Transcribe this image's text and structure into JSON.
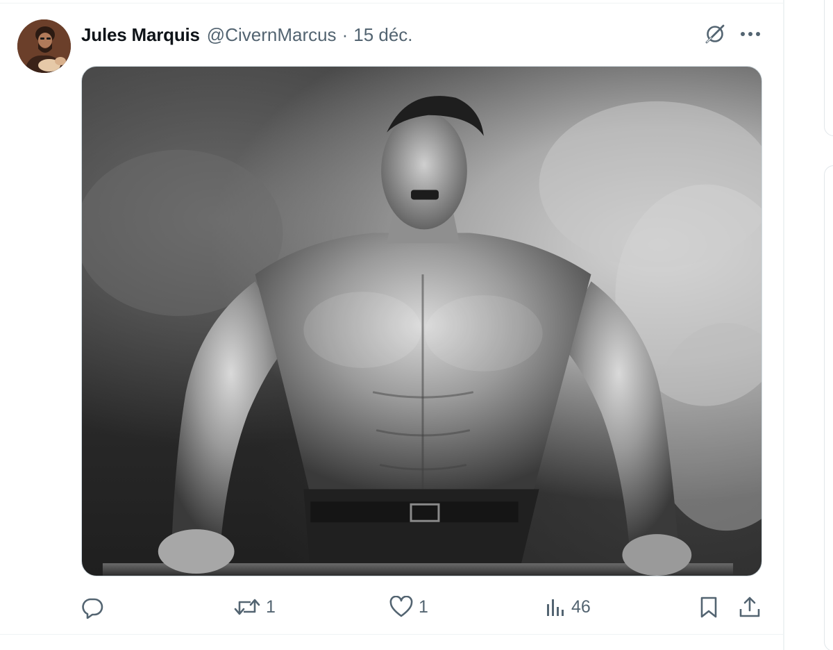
{
  "tweet": {
    "author": {
      "display_name": "Jules Marquis",
      "handle": "@CivernMarcus"
    },
    "separator": "·",
    "date": "15 déc.",
    "media": {
      "icon": "photo"
    },
    "actions": {
      "reply": {
        "icon": "reply-icon",
        "count": ""
      },
      "retweet": {
        "icon": "retweet-icon",
        "count": "1"
      },
      "like": {
        "icon": "heart-icon",
        "count": "1"
      },
      "views": {
        "icon": "views-chart-icon",
        "count": "46"
      },
      "bookmark": {
        "icon": "bookmark-icon"
      },
      "share": {
        "icon": "share-icon"
      }
    }
  },
  "colors": {
    "text_primary": "#0f1419",
    "text_secondary": "#536471",
    "divider": "#eff3f4"
  }
}
